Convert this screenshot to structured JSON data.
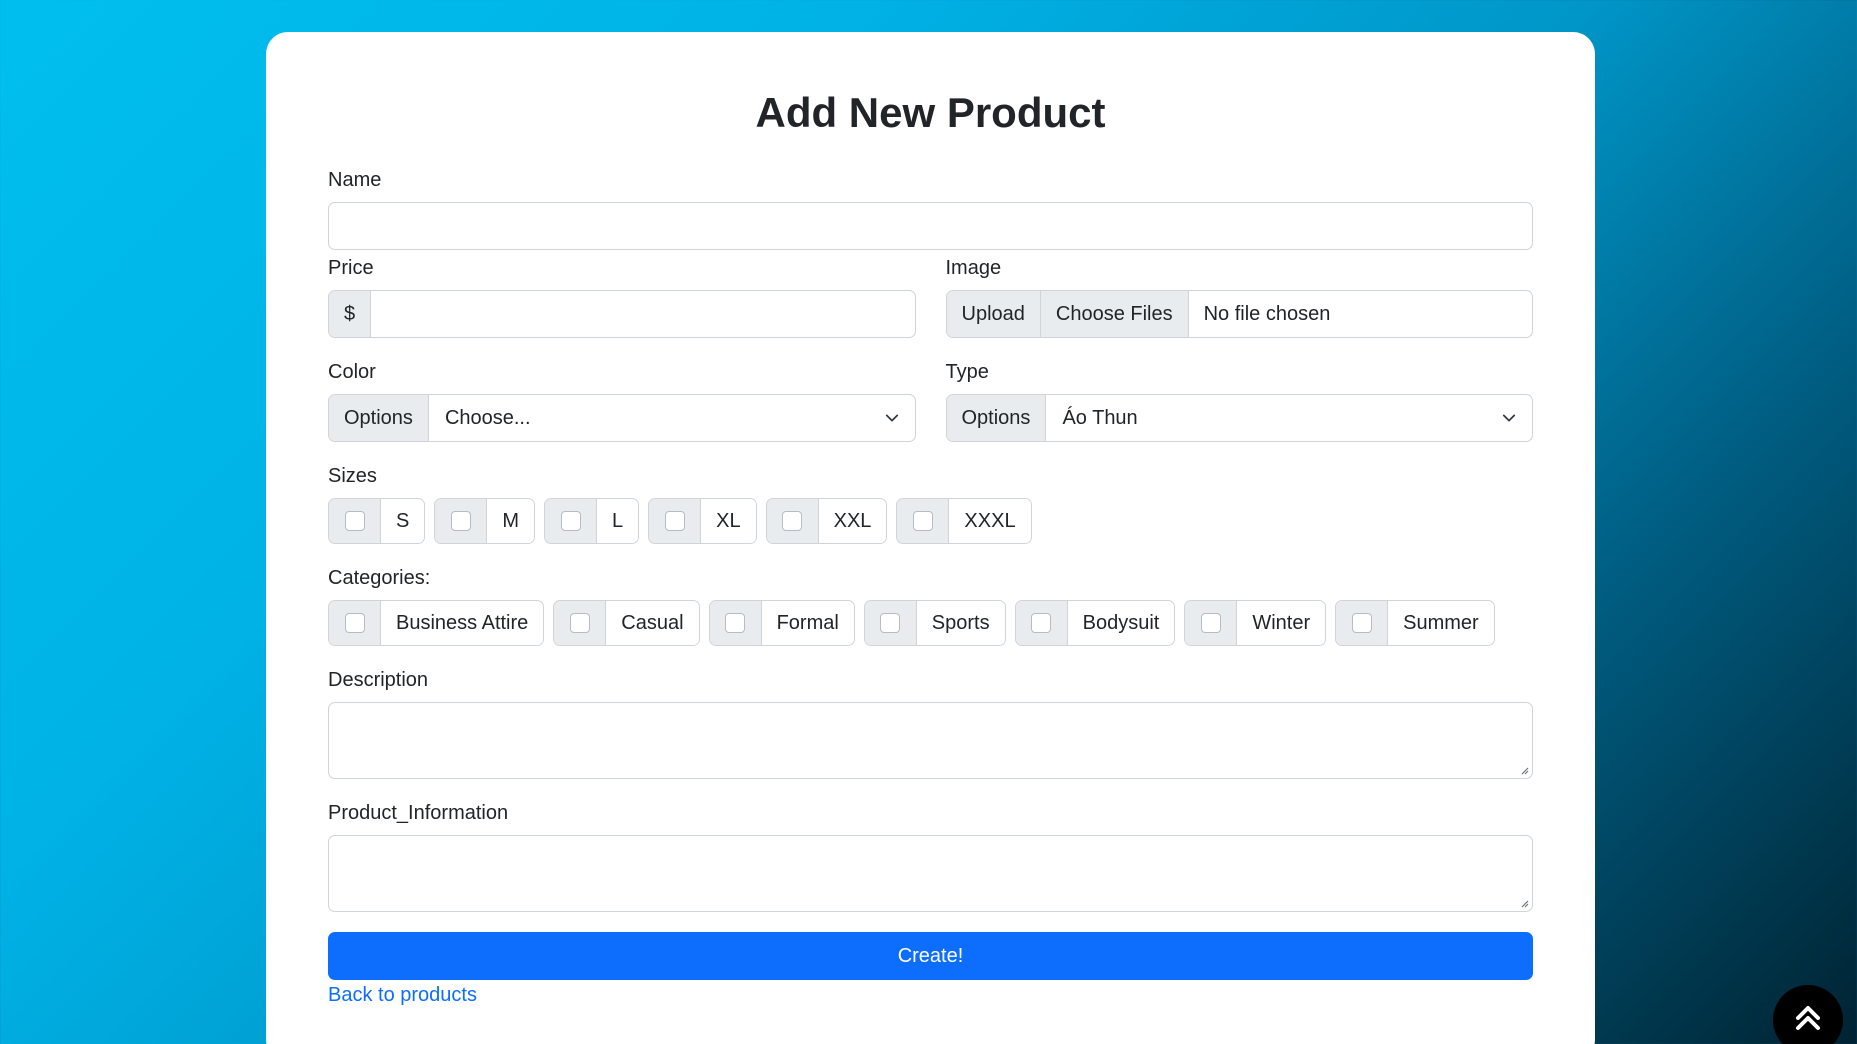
{
  "page": {
    "title": "Add New Product"
  },
  "form": {
    "name": {
      "label": "Name",
      "value": ""
    },
    "price": {
      "label": "Price",
      "prefix": "$",
      "value": ""
    },
    "image": {
      "label": "Image",
      "addon": "Upload",
      "button": "Choose Files",
      "status": "No file chosen"
    },
    "color": {
      "label": "Color",
      "addon": "Options",
      "selected": "Choose..."
    },
    "type": {
      "label": "Type",
      "addon": "Options",
      "selected": "Áo Thun"
    },
    "sizes": {
      "label": "Sizes",
      "options": [
        "S",
        "M",
        "L",
        "XL",
        "XXL",
        "XXXL"
      ]
    },
    "categories": {
      "label": "Categories:",
      "options": [
        "Business Attire",
        "Casual",
        "Formal",
        "Sports",
        "Bodysuit",
        "Winter",
        "Summer"
      ]
    },
    "description": {
      "label": "Description",
      "value": ""
    },
    "product_information": {
      "label": "Product_Information",
      "value": ""
    },
    "submit_label": "Create!",
    "back_link": "Back to products"
  },
  "icons": {
    "select_arrow": "chevron-down-icon",
    "scroll_top": "double-chevron-up-icon"
  },
  "colors": {
    "primary": "#0d6efd",
    "addon_bg": "#e9ecef",
    "border": "#ced4da"
  }
}
